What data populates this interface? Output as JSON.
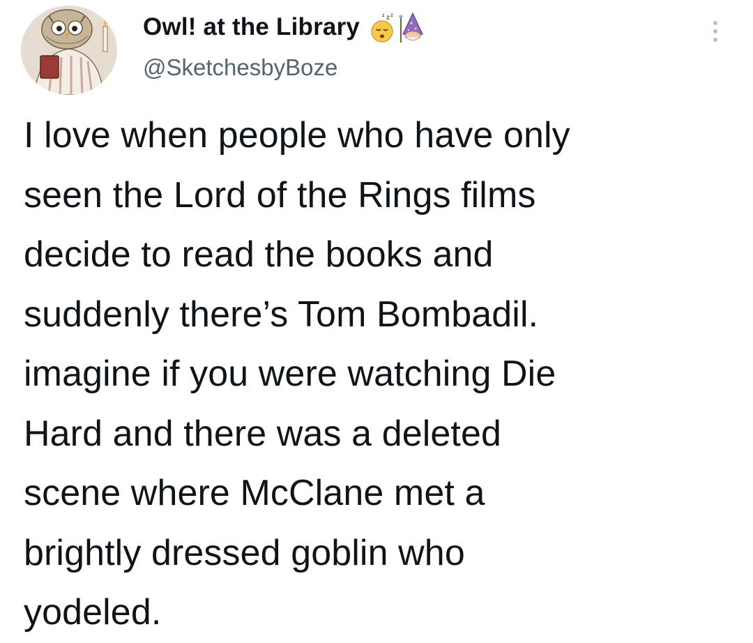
{
  "tweet": {
    "author": {
      "display_name": "Owl! at the Library",
      "handle": "@SketchesbyBoze",
      "avatar_icon": "owl-reading-avatar",
      "name_emojis": [
        "sleeping-face-emoji",
        "mage-emoji"
      ]
    },
    "menu_icon": "more-options-icon",
    "text": "I love when people who have only\nseen the Lord of the Rings films\ndecide to read the books and\nsuddenly there’s Tom Bombadil.\nimagine if you were watching Die\nHard and there was a deleted\nscene where McClane met a\nbrightly dressed goblin who\nyodeled."
  },
  "colors": {
    "text_primary": "#0f1419",
    "text_secondary": "#536471",
    "background": "#ffffff"
  }
}
